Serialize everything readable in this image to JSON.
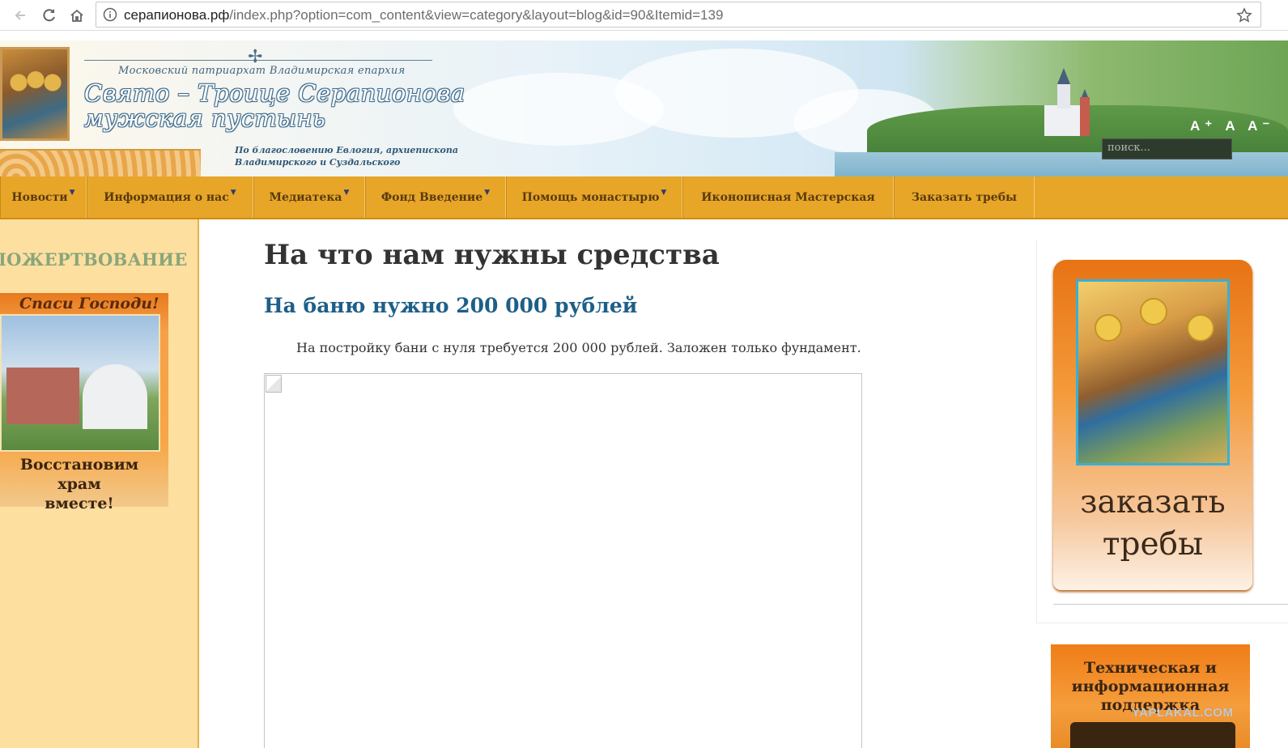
{
  "browser": {
    "url_host": "серапионова.рф",
    "url_path": "/index.php?option=com_content&view=category&layout=blog&id=90&Itemid=139",
    "back_icon": "arrow-left-icon",
    "reload_icon": "reload-icon",
    "home_icon": "home-icon",
    "info_icon": "info-icon",
    "bookmark_icon": "star-icon"
  },
  "header": {
    "top_line": "Московский патриархат Владимирская епархия",
    "title_line1": "Свято – Троице Серапионова",
    "title_line2": "мужская пустынь",
    "blessing_line1": "По благословению Евлогия, архиепископа",
    "blessing_line2": "Владимирского и Суздальского",
    "font_size_controls": "A⁺ A A⁻",
    "search_placeholder": "поиск..."
  },
  "menu": {
    "items": [
      {
        "label": "Новости",
        "has_dropdown": true
      },
      {
        "label": "Информация о нас",
        "has_dropdown": true
      },
      {
        "label": "Медиатека",
        "has_dropdown": true
      },
      {
        "label": "Фонд Введение",
        "has_dropdown": true
      },
      {
        "label": "Помощь монастырю",
        "has_dropdown": true
      },
      {
        "label": "Иконописная Мастерская",
        "has_dropdown": false
      },
      {
        "label": "Заказать требы",
        "has_dropdown": false
      }
    ],
    "arrow_glyph": "▼"
  },
  "left": {
    "heading": "ПОЖЕРТВОВАНИЕ",
    "banner_top": "Спаси Господи!",
    "banner_bottom_line1": "Восстановим храм",
    "banner_bottom_line2": "вместе!"
  },
  "main": {
    "page_title": "На что нам нужны средства",
    "article_title": "На баню нужно 200 000 рублей",
    "article_text": "На постройку бани с нуля требуется 200 000 рублей. Заложен только фундамент."
  },
  "right": {
    "treby_line1": "заказать",
    "treby_line2": "требы",
    "support_line1": "Техническая и",
    "support_line2": "информационная",
    "support_line3": "поддержка"
  },
  "watermark": "YAPLAKAL.COM",
  "colors": {
    "menu_bg": "#e7a628",
    "left_bg": "#fddf9f",
    "article_link": "#1d5f87",
    "heading_green": "#8aa57b"
  }
}
